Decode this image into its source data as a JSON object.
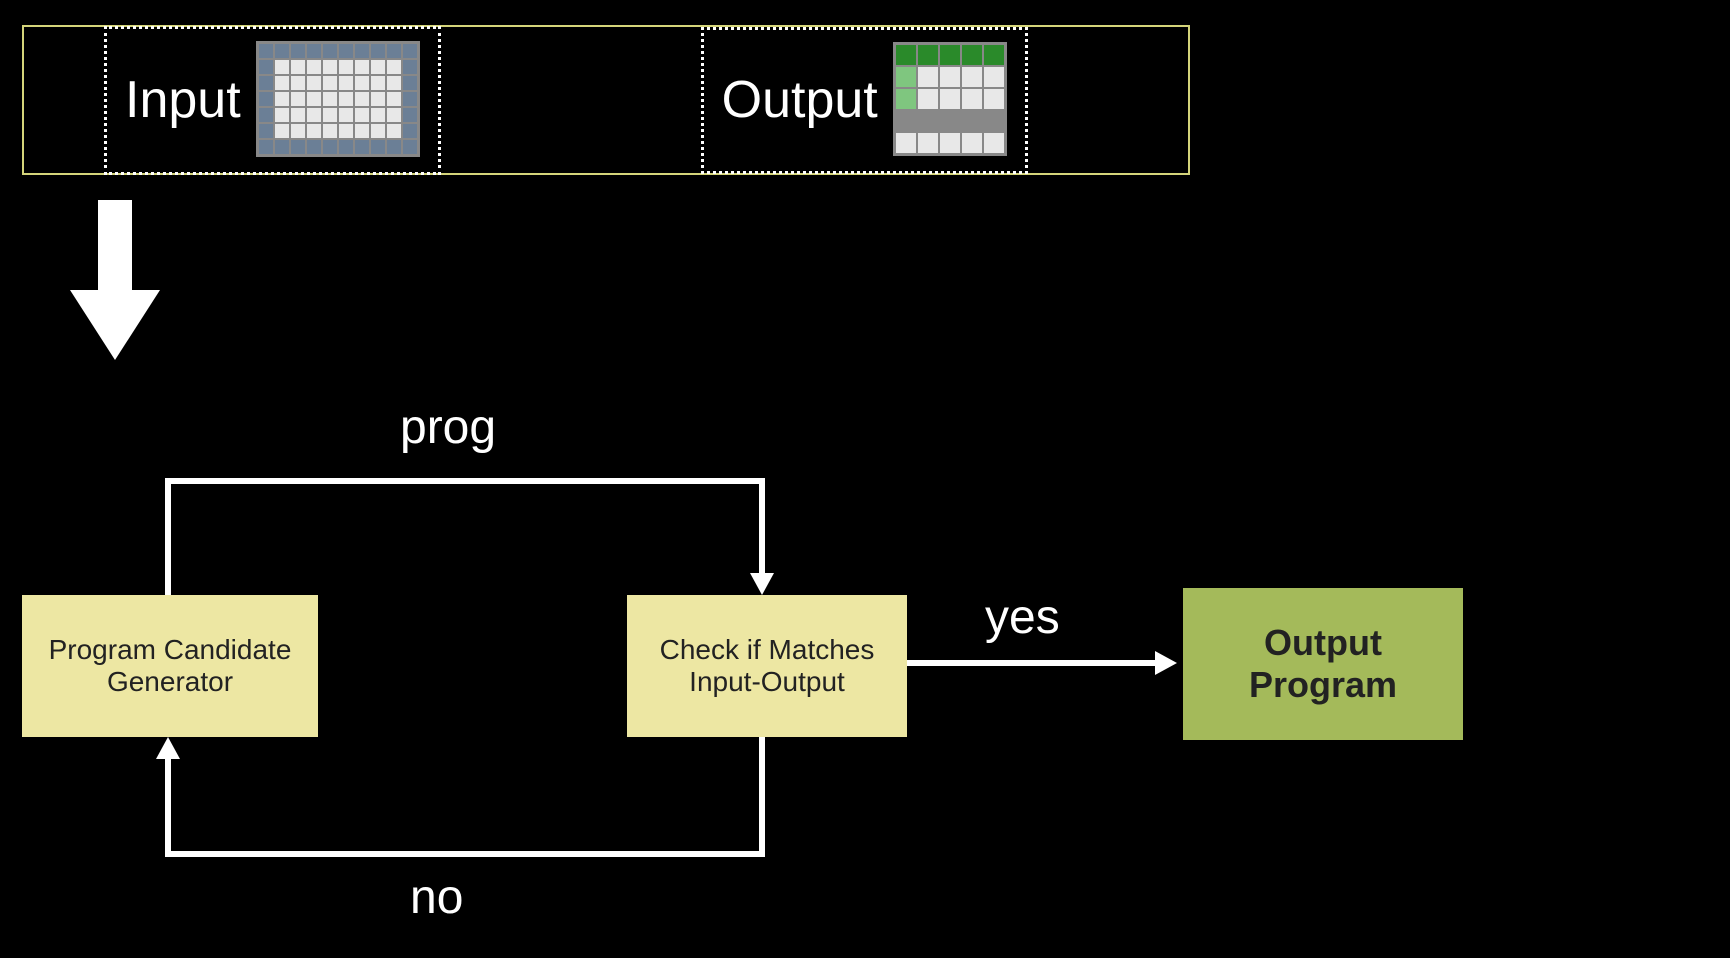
{
  "io": {
    "input_label": "Input",
    "output_label": "Output",
    "input_grid": {
      "rows": 7,
      "cols": 10,
      "cell_size": 16,
      "colors": {
        "border": "#6b7f96",
        "inner": "#e8e8e8"
      }
    },
    "output_grid": {
      "rows": 5,
      "cols": 5,
      "cell_size": 22,
      "color_map": [
        [
          "dg",
          "dg",
          "dg",
          "dg",
          "dg"
        ],
        [
          "lg",
          "w",
          "w",
          "w",
          "w"
        ],
        [
          "lg",
          "w",
          "w",
          "w",
          "w"
        ],
        [
          "g",
          "g",
          "g",
          "g",
          "g"
        ],
        [
          "w",
          "w",
          "w",
          "w",
          "w"
        ]
      ],
      "colors": {
        "dg": "#2a8a2a",
        "lg": "#7fc67f",
        "w": "#e8e8e8",
        "g": "#888888"
      }
    }
  },
  "boxes": {
    "generator": {
      "line1": "Program Candidate",
      "line2": "Generator"
    },
    "checker": {
      "line1": "Check if Matches",
      "line2": "Input-Output"
    },
    "output": {
      "line1": "Output",
      "line2": "Program"
    }
  },
  "edges": {
    "prog": "prog",
    "yes": "yes",
    "no": "no"
  }
}
